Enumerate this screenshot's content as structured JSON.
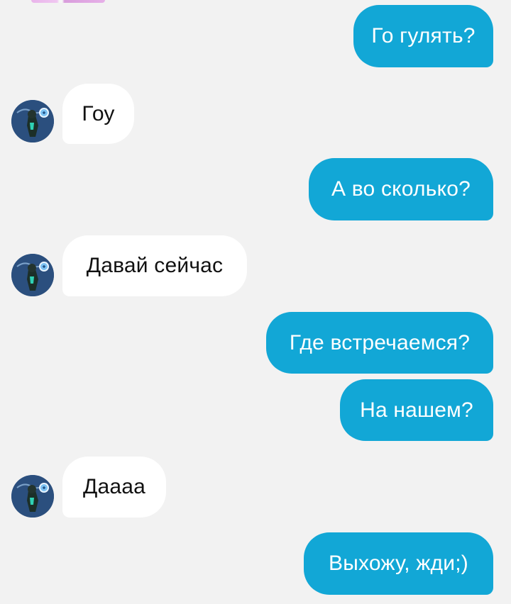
{
  "messages": [
    {
      "direction": "outgoing",
      "text": "Го гулять?"
    },
    {
      "direction": "incoming",
      "text": "Гоу"
    },
    {
      "direction": "outgoing",
      "text": "А во сколько?"
    },
    {
      "direction": "incoming",
      "text": "Давай сейчас"
    },
    {
      "direction": "outgoing",
      "text": "Где встречаемся?"
    },
    {
      "direction": "outgoing",
      "text": "На нашем?"
    },
    {
      "direction": "incoming",
      "text": "Даааа"
    },
    {
      "direction": "outgoing",
      "text": "Выхожу, жди;)"
    }
  ],
  "colors": {
    "outgoing_bubble": "#12a7d6",
    "incoming_bubble": "#ffffff",
    "background": "#f2f2f2"
  },
  "icons": {
    "contact_avatar": "avatar-icon"
  }
}
